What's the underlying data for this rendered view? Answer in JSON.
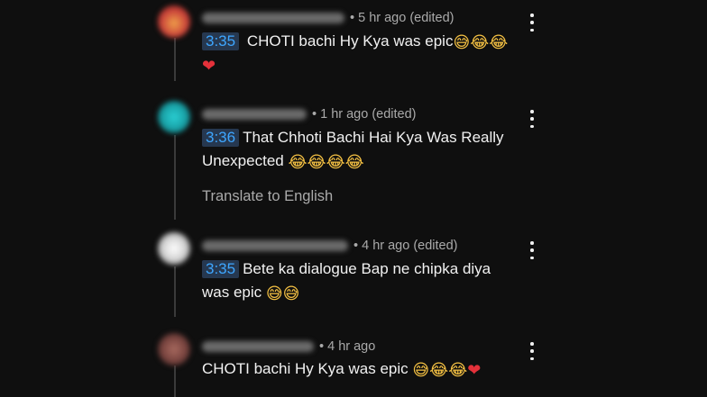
{
  "comments": [
    {
      "time": "• 5 hr ago (edited)",
      "timestamp_link": "3:35",
      "text": "CHOTI bachi Hy Kya was epic",
      "emojis": [
        "😅",
        "😂",
        "😂",
        "❤"
      ],
      "avatar_color": "#c9413a"
    },
    {
      "time": "• 1 hr ago (edited)",
      "timestamp_link": "3:36",
      "text": "That Chhoti Bachi Hai Kya Was Really Unexpected",
      "emojis": [
        "😂",
        "😂",
        "😂",
        "😂"
      ],
      "translate_label": "Translate to English",
      "avatar_color": "#1aa3a8"
    },
    {
      "time": "• 4 hr ago (edited)",
      "timestamp_link": "3:35",
      "text": "Bete ka dialogue Bap ne chipka diya was epic",
      "emojis": [
        "😅",
        "😅"
      ],
      "avatar_color": "#d8d8d8"
    },
    {
      "time": "• 4 hr ago",
      "text": "CHOTI bachi Hy Kya was epic",
      "emojis": [
        "😅",
        "😂",
        "😂",
        "❤"
      ],
      "avatar_color": "#7a4540"
    }
  ],
  "colors": {
    "background": "#0f0f0f",
    "timestamp_link": "#3ea6ff",
    "secondary_text": "#aaaaaa"
  },
  "icons": {
    "more": "more-vertical-icon"
  }
}
